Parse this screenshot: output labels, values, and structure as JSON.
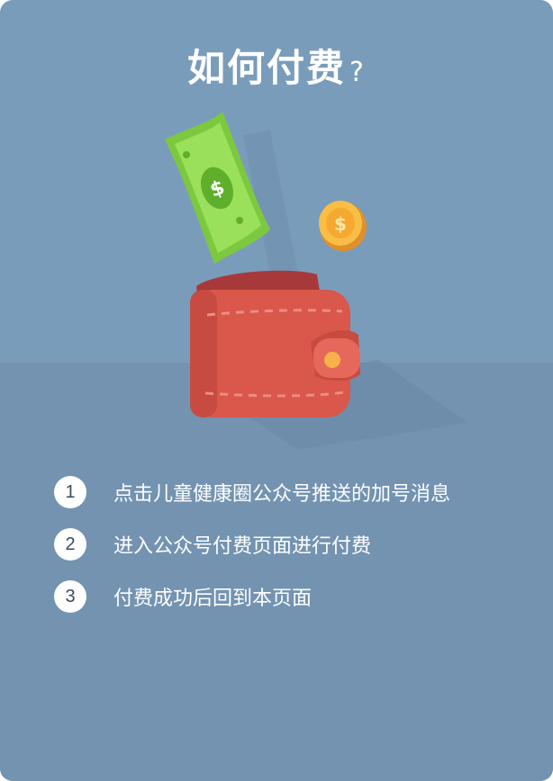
{
  "title": {
    "main": "如何付费",
    "mark": "?"
  },
  "steps": [
    {
      "number": "1",
      "text": "点击儿童健康圈公众号推送的加号消息"
    },
    {
      "number": "2",
      "text": "进入公众号付费页面进行付费"
    },
    {
      "number": "3",
      "text": "付费成功后回到本页面"
    }
  ],
  "illustration": {
    "icons": [
      "banknote-icon",
      "coin-icon",
      "wallet-icon"
    ],
    "currency_symbol": "$"
  },
  "colors": {
    "background_top": "#7a9cbb",
    "background_bottom": "#7393b1",
    "wallet": "#d9574b",
    "bill": "#8fd94a",
    "coin": "#f5a930"
  }
}
